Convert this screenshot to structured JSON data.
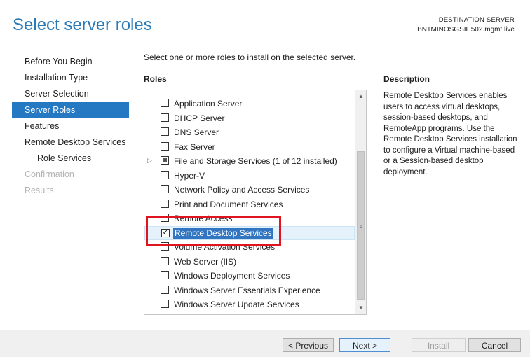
{
  "page": {
    "title": "Select server roles",
    "destination_label": "DESTINATION SERVER",
    "destination_server": "BN1MINOSGSIH502.mgmt.live"
  },
  "nav": {
    "items": [
      {
        "label": "Before You Begin",
        "state": "normal"
      },
      {
        "label": "Installation Type",
        "state": "normal"
      },
      {
        "label": "Server Selection",
        "state": "normal"
      },
      {
        "label": "Server Roles",
        "state": "active"
      },
      {
        "label": "Features",
        "state": "normal"
      },
      {
        "label": "Remote Desktop Services",
        "state": "normal"
      },
      {
        "label": "Role Services",
        "state": "sub"
      },
      {
        "label": "Confirmation",
        "state": "disabled"
      },
      {
        "label": "Results",
        "state": "disabled"
      }
    ]
  },
  "main": {
    "instruction": "Select one or more roles to install on the selected server.",
    "roles_heading": "Roles",
    "roles": [
      {
        "label": "Application Server",
        "checked": false
      },
      {
        "label": "DHCP Server",
        "checked": false
      },
      {
        "label": "DNS Server",
        "checked": false
      },
      {
        "label": "Fax Server",
        "checked": false
      },
      {
        "label": "File and Storage Services (1 of 12 installed)",
        "checked": "partial",
        "expandable": true
      },
      {
        "label": "Hyper-V",
        "checked": false
      },
      {
        "label": "Network Policy and Access Services",
        "checked": false
      },
      {
        "label": "Print and Document Services",
        "checked": false
      },
      {
        "label": "Remote Access",
        "checked": false
      },
      {
        "label": "Remote Desktop Services",
        "checked": true,
        "selected": true
      },
      {
        "label": "Volume Activation Services",
        "checked": false
      },
      {
        "label": "Web Server (IIS)",
        "checked": false
      },
      {
        "label": "Windows Deployment Services",
        "checked": false
      },
      {
        "label": "Windows Server Essentials Experience",
        "checked": false
      },
      {
        "label": "Windows Server Update Services",
        "checked": false
      }
    ]
  },
  "description": {
    "heading": "Description",
    "text": "Remote Desktop Services enables users to access virtual desktops, session-based desktops, and RemoteApp programs. Use the Remote Desktop Services installation to configure a Virtual machine-based or a Session-based desktop deployment."
  },
  "footer": {
    "previous": "< Previous",
    "next": "Next >",
    "install": "Install",
    "cancel": "Cancel"
  },
  "colors": {
    "title": "#2b7ab8",
    "nav_active_bg": "#2578c2",
    "highlight_box": "#e0141e"
  },
  "icons": {
    "check": "✓",
    "expander": "▷",
    "scroll_up": "▲",
    "scroll_down": "▼",
    "grip": "≡"
  }
}
